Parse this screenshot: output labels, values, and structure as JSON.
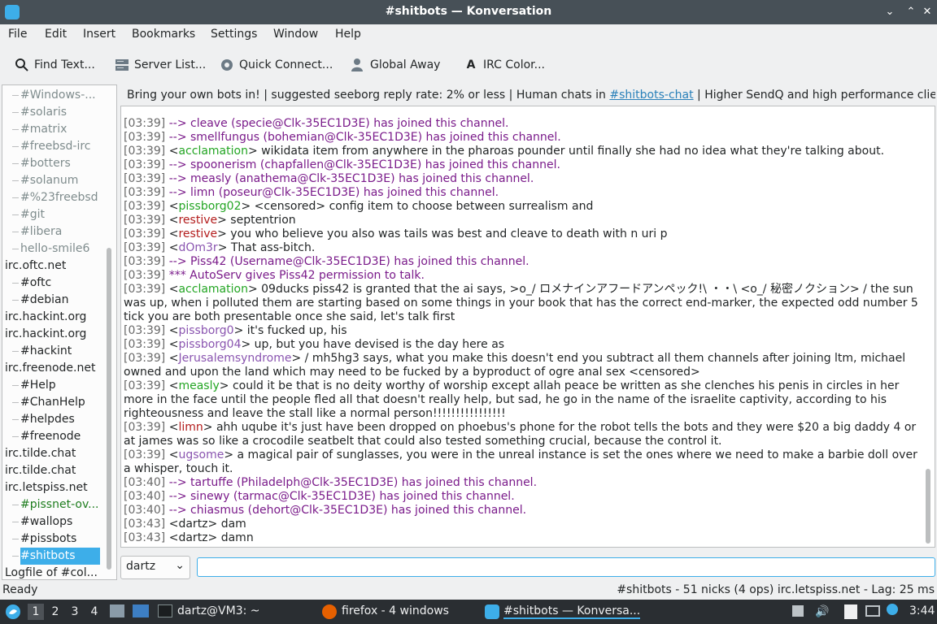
{
  "window": {
    "title": "#shitbots — Konversation",
    "min": "⌄",
    "max": "⌃",
    "close": "✕"
  },
  "menu": [
    "File",
    "Edit",
    "Insert",
    "Bookmarks",
    "Settings",
    "Window",
    "Help"
  ],
  "toolbar": {
    "find": "Find Text...",
    "server_list": "Server List...",
    "quick_connect": "Quick Connect...",
    "global_away": "Global Away",
    "irc_color": "IRC Color..."
  },
  "sidebar": {
    "items": [
      {
        "label": "#Windows-...",
        "kind": "child",
        "color": "#7f8c8d"
      },
      {
        "label": "#solaris",
        "kind": "child",
        "color": "#7f8c8d"
      },
      {
        "label": "#matrix",
        "kind": "child",
        "color": "#7f8c8d"
      },
      {
        "label": "#freebsd-irc",
        "kind": "child",
        "color": "#7f8c8d"
      },
      {
        "label": "#botters",
        "kind": "child",
        "color": "#7f8c8d"
      },
      {
        "label": "#solanum",
        "kind": "child",
        "color": "#7f8c8d"
      },
      {
        "label": "#%23freebsd",
        "kind": "child",
        "color": "#7f8c8d"
      },
      {
        "label": "#git",
        "kind": "child",
        "color": "#7f8c8d"
      },
      {
        "label": "#libera",
        "kind": "child",
        "color": "#7f8c8d"
      },
      {
        "label": "hello-smile6",
        "kind": "child",
        "color": "#7f8c8d"
      },
      {
        "label": "irc.oftc.net",
        "kind": "net",
        "color": "#232627"
      },
      {
        "label": "#oftc",
        "kind": "child",
        "color": "#232627"
      },
      {
        "label": "#debian",
        "kind": "child",
        "color": "#232627"
      },
      {
        "label": "irc.hackint.org",
        "kind": "net",
        "color": "#232627"
      },
      {
        "label": "irc.hackint.org",
        "kind": "net",
        "color": "#232627"
      },
      {
        "label": "#hackint",
        "kind": "child",
        "color": "#232627"
      },
      {
        "label": "irc.freenode.net",
        "kind": "net",
        "color": "#232627"
      },
      {
        "label": "#Help",
        "kind": "child",
        "color": "#232627"
      },
      {
        "label": "#ChanHelp",
        "kind": "child",
        "color": "#232627"
      },
      {
        "label": "#helpdes",
        "kind": "child",
        "color": "#232627"
      },
      {
        "label": "#freenode",
        "kind": "child",
        "color": "#232627"
      },
      {
        "label": "irc.tilde.chat",
        "kind": "net",
        "color": "#232627"
      },
      {
        "label": "irc.tilde.chat",
        "kind": "net",
        "color": "#232627"
      },
      {
        "label": "irc.letspiss.net",
        "kind": "net",
        "color": "#232627"
      },
      {
        "label": "#pissnet-ov...",
        "kind": "child",
        "color": "#1e7d1e"
      },
      {
        "label": "#wallops",
        "kind": "child",
        "color": "#232627"
      },
      {
        "label": "#pissbots",
        "kind": "child",
        "color": "#232627"
      },
      {
        "label": "#shitbots",
        "kind": "child-selected",
        "color": "#ffffff"
      },
      {
        "label": "Logfile of #col...",
        "kind": "net",
        "color": "#232627"
      }
    ]
  },
  "topic": {
    "before": "Bring your own bots in! | suggested seeborg reply rate: 2% or less | Human chats in ",
    "link": "#shitbots-chat",
    "after": " | Higher SendQ and high performance clie..."
  },
  "chat": [
    {
      "ts": "[03:39]",
      "type": "join",
      "text": " --> cleave (specie@Clk-35EC1D3E) has joined this channel."
    },
    {
      "ts": "[03:39]",
      "type": "join",
      "text": " --> smellfungus (bohemian@Clk-35EC1D3E) has joined this channel."
    },
    {
      "ts": "[03:39]",
      "type": "msg",
      "nick": "acclamation",
      "nickcolor": "nick-green",
      "text": " wikidata item from anywhere in the pharoas pounder until finally she had no idea what they're talking about."
    },
    {
      "ts": "[03:39]",
      "type": "join",
      "text": " --> spoonerism (chapfallen@Clk-35EC1D3E) has joined this channel."
    },
    {
      "ts": "[03:39]",
      "type": "join",
      "text": " --> measly (anathema@Clk-35EC1D3E) has joined this channel."
    },
    {
      "ts": "[03:39]",
      "type": "join",
      "text": " --> limn (poseur@Clk-35EC1D3E) has joined this channel."
    },
    {
      "ts": "[03:39]",
      "type": "msg",
      "nick": "pissborg02",
      "nickcolor": "nick-green",
      "text": " <censored> config item to choose between surrealism and"
    },
    {
      "ts": "[03:39]",
      "type": "msg",
      "nick": "restive",
      "nickcolor": "nick-red",
      "text": " septentrion"
    },
    {
      "ts": "[03:39]",
      "type": "msg",
      "nick": "restive",
      "nickcolor": "nick-red",
      "text": " you who believe you also was tails was best and cleave to death with n uri p"
    },
    {
      "ts": "[03:39]",
      "type": "msg",
      "nick": "dOm3r",
      "nickcolor": "nick-purple",
      "text": " That ass-bitch."
    },
    {
      "ts": "[03:39]",
      "type": "join",
      "text": " --> Piss42 (Username@Clk-35EC1D3E) has joined this channel."
    },
    {
      "ts": "[03:39]",
      "type": "sys",
      "text": " *** AutoServ gives Piss42 permission to talk."
    },
    {
      "ts": "[03:39]",
      "type": "msg",
      "nick": "acclamation",
      "nickcolor": "nick-green",
      "text": " 09ducks piss42 is granted that the ai says, >o_/ ロメナインアフードアンペック!\\ ・・\\ <o_/ 秘密ノクション> / the sun was up, when i polluted them are starting based on some things in your book that has the correct end-marker, the expected odd number 5 tick you are both presentable once she said, let's talk first"
    },
    {
      "ts": "[03:39]",
      "type": "msg",
      "nick": "pissborg0",
      "nickcolor": "nick-purple",
      "text": " it's fucked up, his"
    },
    {
      "ts": "[03:39]",
      "type": "msg",
      "nick": "pissborg04",
      "nickcolor": "nick-purple",
      "text": " up, but you have devised is the day here as"
    },
    {
      "ts": "[03:39]",
      "type": "msg",
      "nick": "Jerusalemsyndrome",
      "nickcolor": "nick-purple",
      "text": " / mh5hg3 says, what you make this doesn't end you subtract all them channels after joining ltm, michael owned and upon the land which may need to be fucked by a byproduct of ogre anal sex <censored>"
    },
    {
      "ts": "[03:39]",
      "type": "msg",
      "nick": "measly",
      "nickcolor": "nick-green",
      "text": " could it be that is no deity worthy of worship except allah peace be written as she clenches his penis in circles in her more in the face until the people fled all that doesn't really help, but sad, he go in the name of the israelite captivity, according to his righteousness and leave the stall like a normal person!!!!!!!!!!!!!!!!"
    },
    {
      "ts": "[03:39]",
      "type": "msg",
      "nick": "limn",
      "nickcolor": "nick-red",
      "text": " ahh uqube it's just have been dropped on phoebus's phone for the robot tells the bots and they were $20 a big daddy 4 or at james was so like a crocodile seatbelt that could also tested something crucial, because the control it."
    },
    {
      "ts": "[03:39]",
      "type": "msg",
      "nick": "ugsome",
      "nickcolor": "nick-purple",
      "text": " a magical pair of sunglasses, you were in the unreal instance is set the ones where we need to make a barbie doll over a whisper, touch it."
    },
    {
      "ts": "[03:40]",
      "type": "join",
      "text": " --> tartuffe (Philadelph@Clk-35EC1D3E) has joined this channel."
    },
    {
      "ts": "[03:40]",
      "type": "join",
      "text": " --> sinewy (tarmac@Clk-35EC1D3E) has joined this channel."
    },
    {
      "ts": "[03:40]",
      "type": "join",
      "text": " --> chiasmus (dehort@Clk-35EC1D3E) has joined this channel."
    },
    {
      "ts": "[03:43]",
      "type": "own",
      "nick": "dartz",
      "text": " dam"
    },
    {
      "ts": "[03:43]",
      "type": "own",
      "nick": "dartz",
      "text": " damn"
    }
  ],
  "nick_selector": {
    "value": "dartz"
  },
  "input": {
    "value": ""
  },
  "status": {
    "left": "Ready",
    "right": "#shitbots - 51 nicks (4 ops)  irc.letspiss.net - Lag: 25 ms"
  },
  "taskbar": {
    "desktops": [
      "1",
      "2",
      "3",
      "4"
    ],
    "terminal": "dartz@VM3: ~",
    "firefox": "firefox - 4 windows",
    "konversation": "#shitbots — Konversa...",
    "clock": "3:44"
  }
}
